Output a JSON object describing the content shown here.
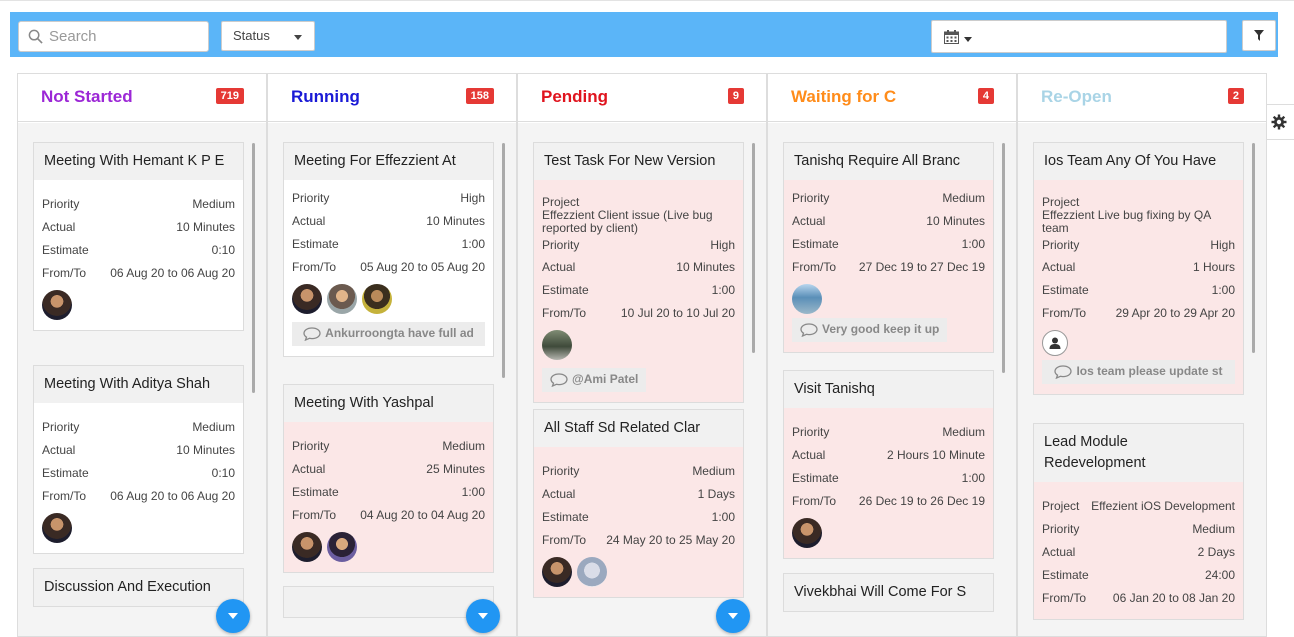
{
  "toolbar": {
    "search_placeholder": "Search",
    "status_label": "Status",
    "date_range_value": ""
  },
  "colors": {
    "toolbar_bg": "#5bb5f8",
    "not_started": "#9c27d6",
    "running": "#1a1ad6",
    "pending": "#e0141e",
    "waiting": "#ff8c1a",
    "reopen": "#a9d4e6",
    "badge": "#e53935",
    "fab": "#2196f3"
  },
  "columns": [
    {
      "title": "Not Started",
      "count": "719",
      "cards": [
        {
          "title": "Meeting With Hemant K P E",
          "fields": [
            [
              "Priority",
              "Medium"
            ],
            [
              "Actual",
              "10 Minutes"
            ],
            [
              "Estimate",
              "0:10"
            ],
            [
              "From/To",
              "06 Aug 20 to 06 Aug 20"
            ]
          ]
        },
        {
          "title": "Meeting With Aditya Shah",
          "fields": [
            [
              "Priority",
              "Medium"
            ],
            [
              "Actual",
              "10 Minutes"
            ],
            [
              "Estimate",
              "0:10"
            ],
            [
              "From/To",
              "06 Aug 20 to 06 Aug 20"
            ]
          ]
        },
        {
          "title": "Discussion And Execution"
        }
      ]
    },
    {
      "title": "Running",
      "count": "158",
      "cards": [
        {
          "title": "Meeting For Effezzient At",
          "fields": [
            [
              "Priority",
              "High"
            ],
            [
              "Actual",
              "10 Minutes"
            ],
            [
              "Estimate",
              "1:00"
            ],
            [
              "From/To",
              "05 Aug 20 to 05 Aug 20"
            ]
          ],
          "comment": "Ankurroongta have full ad"
        },
        {
          "title": "Meeting With Yashpal",
          "fields": [
            [
              "Priority",
              "Medium"
            ],
            [
              "Actual",
              "25 Minutes"
            ],
            [
              "Estimate",
              "1:00"
            ],
            [
              "From/To",
              "04 Aug 20 to 04 Aug 20"
            ]
          ]
        }
      ]
    },
    {
      "title": "Pending",
      "count": "9",
      "cards": [
        {
          "title": "Test Task For New Version",
          "project_label": "Project",
          "project": "Effezzient Client issue (Live bug reported by client)",
          "fields": [
            [
              "Priority",
              "High"
            ],
            [
              "Actual",
              "10 Minutes"
            ],
            [
              "Estimate",
              "1:00"
            ],
            [
              "From/To",
              "10 Jul 20 to 10 Jul 20"
            ]
          ],
          "comment": "@Ami Patel"
        },
        {
          "title": "All Staff Sd Related Clar",
          "fields": [
            [
              "Priority",
              "Medium"
            ],
            [
              "Actual",
              "1 Days"
            ],
            [
              "Estimate",
              "1:00"
            ],
            [
              "From/To",
              "24 May 20 to 25 May 20"
            ]
          ]
        }
      ]
    },
    {
      "title": "Waiting for C",
      "count": "4",
      "cards": [
        {
          "title": "Tanishq Require All Branc",
          "fields": [
            [
              "Priority",
              "Medium"
            ],
            [
              "Actual",
              "10 Minutes"
            ],
            [
              "Estimate",
              "1:00"
            ],
            [
              "From/To",
              "27 Dec 19 to 27 Dec 19"
            ]
          ],
          "comment": "Very good keep it up"
        },
        {
          "title": "Visit Tanishq",
          "fields": [
            [
              "Priority",
              "Medium"
            ],
            [
              "Actual",
              "2 Hours 10 Minute"
            ],
            [
              "Estimate",
              "1:00"
            ],
            [
              "From/To",
              "26 Dec 19 to 26 Dec 19"
            ]
          ]
        },
        {
          "title": "Vivekbhai Will Come For S"
        }
      ]
    },
    {
      "title": "Re-Open",
      "count": "2",
      "cards": [
        {
          "title": "Ios Team Any Of You Have",
          "project_label": "Project",
          "project": "Effezzient Live bug fixing by QA team",
          "fields": [
            [
              "Priority",
              "High"
            ],
            [
              "Actual",
              "1 Hours"
            ],
            [
              "Estimate",
              "1:00"
            ],
            [
              "From/To",
              "29 Apr 20 to 29 Apr 20"
            ]
          ],
          "comment": "Ios team please update st"
        },
        {
          "title": "Lead Module Redevelopment",
          "project_label": "Project",
          "project": "Effezient iOS Development",
          "fields": [
            [
              "Priority",
              "Medium"
            ],
            [
              "Actual",
              "2 Days"
            ],
            [
              "Estimate",
              "24:00"
            ],
            [
              "From/To",
              "06 Jan 20 to 08 Jan 20"
            ]
          ]
        }
      ]
    }
  ]
}
